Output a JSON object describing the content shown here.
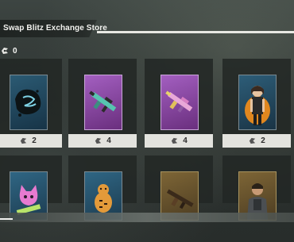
{
  "store": {
    "title": "Swap Blitz Exchange Store"
  },
  "currency": {
    "icon": "token-icon",
    "amount": "0"
  },
  "items": [
    {
      "name": "spray-item",
      "price": "2",
      "art_colors": [
        "#1b3d4f",
        "#27566b"
      ]
    },
    {
      "name": "weapon-blueprint-teal",
      "price": "4",
      "art_colors": [
        "#7a3b8d",
        "#9a55b0"
      ]
    },
    {
      "name": "weapon-blueprint-pink",
      "price": "4",
      "art_colors": [
        "#7a3b8d",
        "#9a55b0"
      ]
    },
    {
      "name": "character-skin",
      "price": "2",
      "art_colors": [
        "#1f3c4e",
        "#2a5369"
      ]
    },
    {
      "name": "sticker-cat",
      "price": "",
      "art_colors": [
        "#234a63",
        "#2d5f7c"
      ]
    },
    {
      "name": "sticker-tiger",
      "price": "",
      "art_colors": [
        "#234a63",
        "#2d5f7c"
      ]
    },
    {
      "name": "weapon-blueprint-gold",
      "price": "",
      "art_colors": [
        "#5c4a2a",
        "#7a6235"
      ]
    },
    {
      "name": "operator-skin",
      "price": "",
      "art_colors": [
        "#5c4a2a",
        "#7a6235"
      ]
    }
  ],
  "colors": {
    "price_bg": "#e3e3de",
    "title_bg": "#1f2422",
    "accent_stripe": "#e8e8e3"
  }
}
